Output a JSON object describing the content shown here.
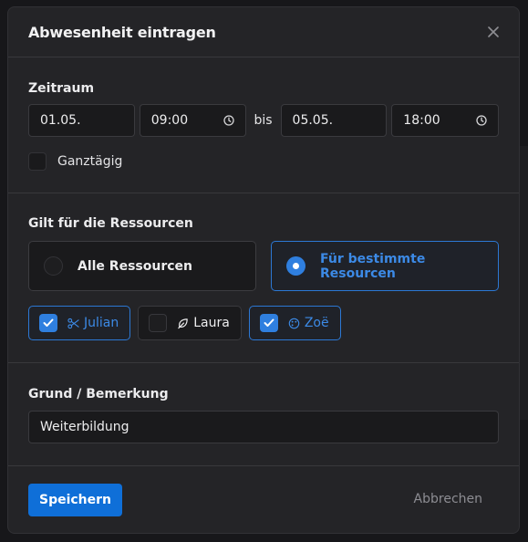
{
  "dialog": {
    "title": "Abwesenheit eintragen"
  },
  "period": {
    "label": "Zeitraum",
    "start_date": "01.05.",
    "start_time": "09:00",
    "separator": "bis",
    "end_date": "05.05.",
    "end_time": "18:00",
    "all_day_label": "Ganztägig",
    "all_day_checked": false
  },
  "resources": {
    "label": "Gilt für die Ressourcen",
    "options": [
      {
        "label": "Alle Ressourcen",
        "selected": false
      },
      {
        "label": "Für bestimmte Resourcen",
        "selected": true
      }
    ],
    "people": [
      {
        "name": "Julian",
        "icon": "scissors-icon",
        "checked": true
      },
      {
        "name": "Laura",
        "icon": "leaf-icon",
        "checked": false
      },
      {
        "name": "Zoë",
        "icon": "palette-icon",
        "checked": true
      }
    ]
  },
  "note": {
    "label": "Grund / Bemerkung",
    "value": "Weiterbildung"
  },
  "actions": {
    "save": "Speichern",
    "cancel": "Abbrechen"
  },
  "colors": {
    "accent": "#2f7fdf",
    "save_button": "#0f6fd8",
    "background": "#242427"
  }
}
